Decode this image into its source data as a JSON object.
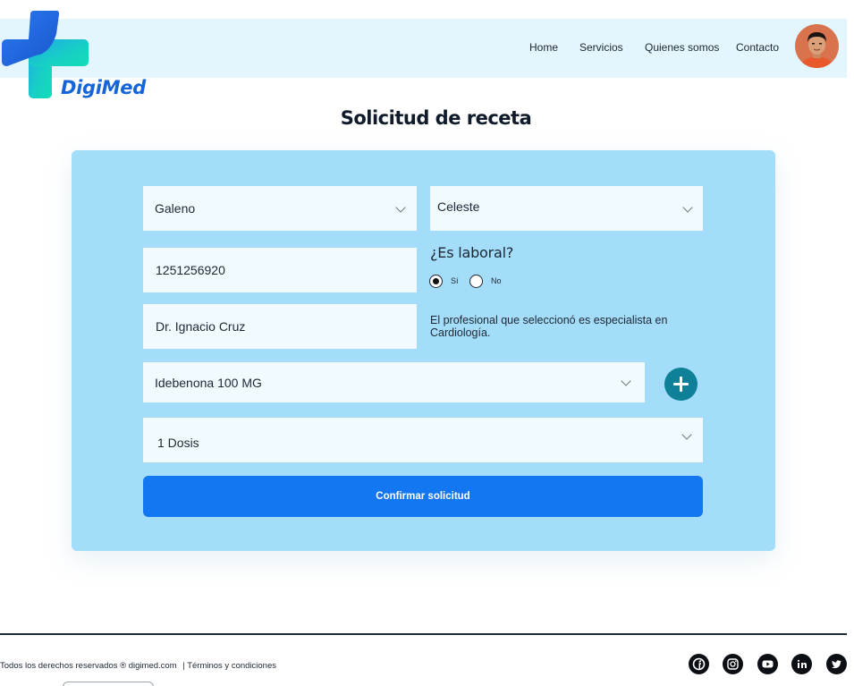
{
  "brand": {
    "name": "DigiMed"
  },
  "nav": {
    "items": [
      "Home",
      "Servicios",
      "Quienes somos",
      "Contacto"
    ]
  },
  "page": {
    "title": "Solicitud de receta"
  },
  "form": {
    "obra_social": {
      "value": "Galeno"
    },
    "plan": {
      "value": "Celeste"
    },
    "afiliado": {
      "value": "1251256920"
    },
    "laboral": {
      "question": "¿Es laboral?",
      "options": [
        "Sí",
        "No"
      ],
      "selected": "Sí"
    },
    "profesional": {
      "value": "Dr. Ignacio Cruz"
    },
    "specialist_note": "El profesional que seleccionó es especialista en Cardiología.",
    "medicamento": {
      "value": "Idebenona 100 MG"
    },
    "dosis": {
      "value": "1 Dosis"
    },
    "confirm_label": "Confirmar solicitud"
  },
  "footer": {
    "copyright": "Todos los derechos reservados ® digimed.com",
    "separator": "|",
    "terms": "Términos y condiciones",
    "socials": [
      "facebook-icon",
      "instagram-icon",
      "youtube-icon",
      "linkedin-icon",
      "twitter-icon"
    ]
  },
  "colors": {
    "header_bg": "#e3f5fd",
    "card_bg": "#a4ddfa",
    "primary": "#1477f2",
    "add_button": "#0e8098",
    "logo_blue": "#1665d8",
    "logo_teal": "#17d0c4"
  }
}
